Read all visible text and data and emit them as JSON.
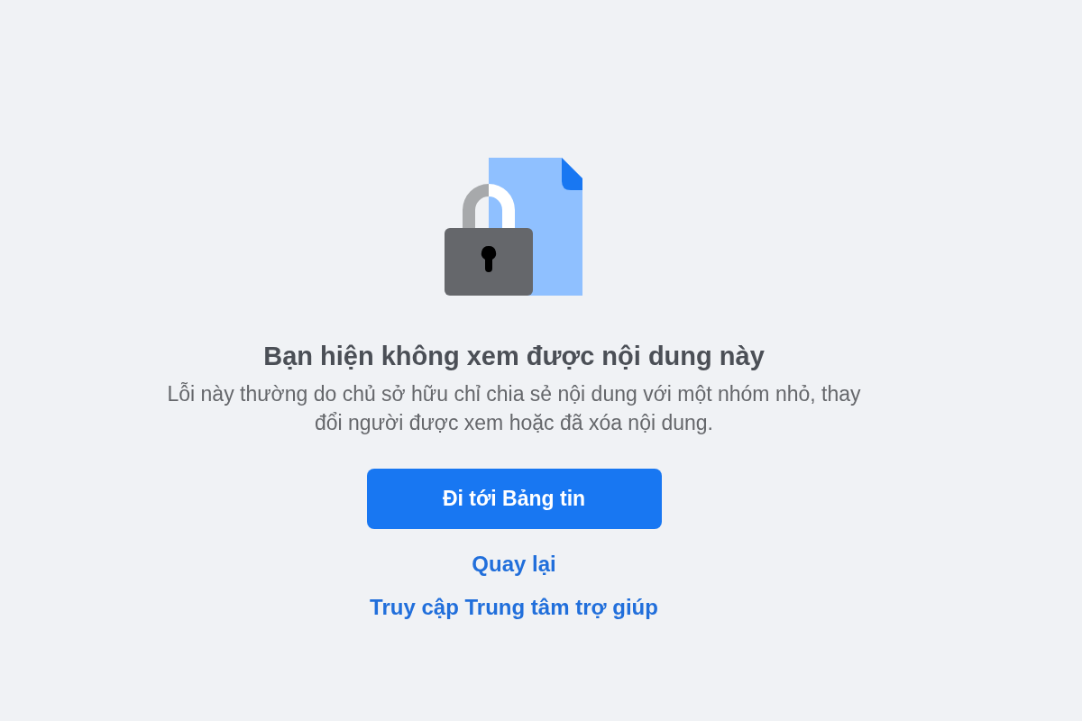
{
  "title": "Bạn hiện không xem được nội dung này",
  "description": "Lỗi này thường do chủ sở hữu chỉ chia sẻ nội dung với một nhóm nhỏ, thay đổi người được xem hoặc đã xóa nội dung.",
  "primary_button": "Đi tới Bảng tin",
  "links": [
    "Quay lại",
    "Truy cập Trung tâm trợ giúp"
  ]
}
